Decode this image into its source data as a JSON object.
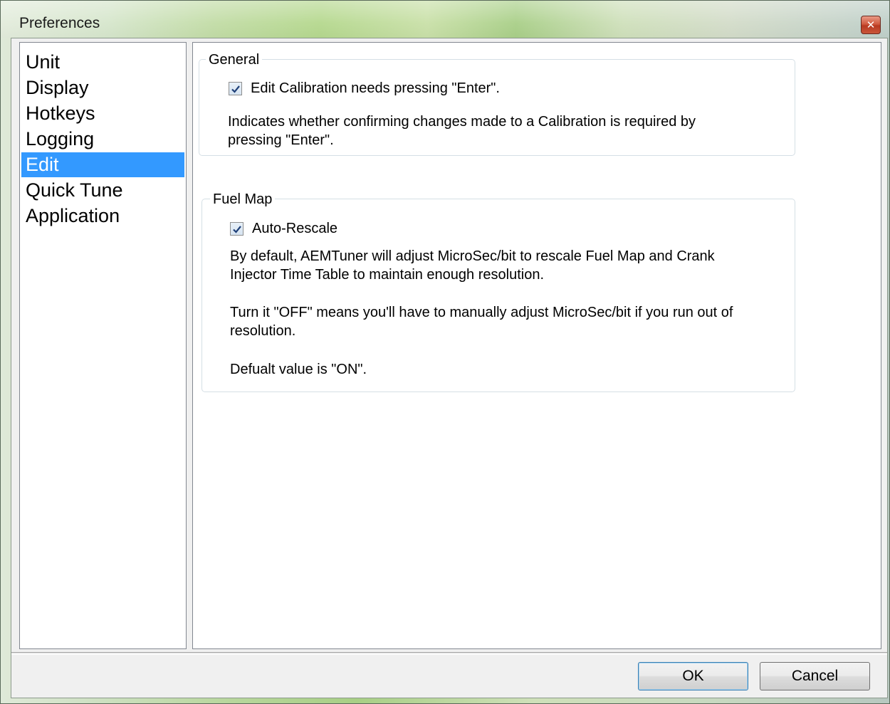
{
  "window": {
    "title": "Preferences",
    "close_glyph": "✕"
  },
  "sidebar": {
    "items": [
      {
        "label": "Unit"
      },
      {
        "label": "Display"
      },
      {
        "label": "Hotkeys"
      },
      {
        "label": "Logging"
      },
      {
        "label": "Edit",
        "selected": true
      },
      {
        "label": "Quick Tune"
      },
      {
        "label": "Application"
      }
    ]
  },
  "general": {
    "title": "General",
    "checkbox_label": "Edit Calibration needs pressing \"Enter\".",
    "checked": true,
    "description_line1": "Indicates whether confirming changes made to a Calibration is required by",
    "description_line2": "pressing \"Enter\"."
  },
  "fuel_map": {
    "title": "Fuel Map",
    "checkbox_label": "Auto-Rescale",
    "checked": true,
    "paragraph1_line1": "By default, AEMTuner will adjust MicroSec/bit to rescale Fuel Map and Crank",
    "paragraph1_line2": "Injector Time Table to maintain enough resolution.",
    "paragraph2_line1": "Turn it \"OFF\" means you'll have to manually adjust MicroSec/bit if you run out of",
    "paragraph2_line2": "resolution.",
    "paragraph3": "Defualt value is \"ON\"."
  },
  "buttons": {
    "ok": "OK",
    "cancel": "Cancel"
  },
  "colors": {
    "selection": "#3399ff",
    "close_button": "#c9563a"
  },
  "icons": {
    "close": "close-icon",
    "check": "checkmark-icon"
  }
}
